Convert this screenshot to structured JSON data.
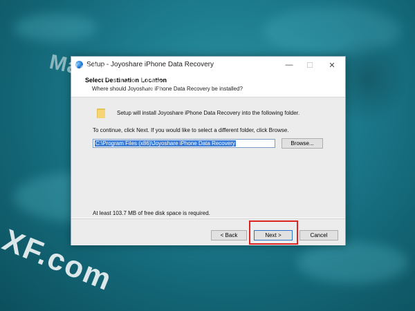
{
  "window": {
    "title": "Setup - Joyoshare iPhone Data Recovery",
    "minimize_glyph": "—",
    "maximize_glyph": "☐",
    "close_glyph": "✕"
  },
  "header": {
    "title": "Select Destination Location",
    "subtitle": "Where should Joyoshare iPhone Data Recovery be installed?"
  },
  "body": {
    "info_text": "Setup will install Joyoshare iPhone Data Recovery into the following folder.",
    "continue_text": "To continue, click Next. If you would like to select a different folder, click Browse.",
    "path_value": "C:\\Program Files (x86)\\Joyoshare iPhone Data Recovery",
    "browse_label": "Browse...",
    "space_text": "At least 103.7 MB of free disk space is required."
  },
  "footer": {
    "back_label": "< Back",
    "next_label": "Next >",
    "cancel_label": "Cancel"
  },
  "watermark": {
    "top": "MacXf.com",
    "bottom": "XF.com"
  },
  "icons": {
    "app": "installer-app-icon",
    "folder": "folder-icon"
  },
  "colors": {
    "highlight": "#dd2222",
    "selection": "#3a7bd5"
  }
}
